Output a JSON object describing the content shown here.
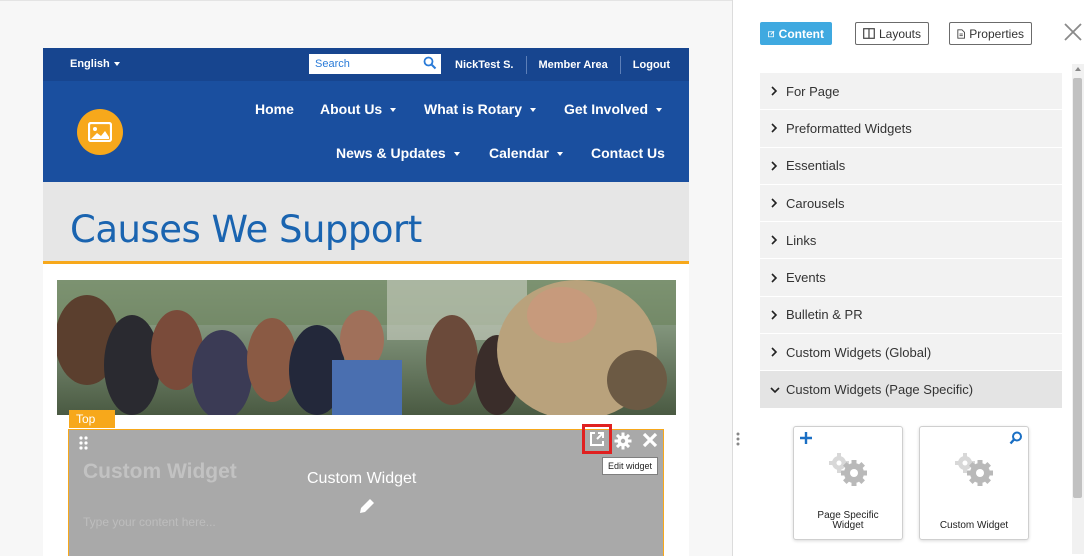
{
  "site": {
    "topbar": {
      "language": "English",
      "search_placeholder": "Search",
      "user": "NickTest S.",
      "member_area": "Member Area",
      "logout": "Logout"
    },
    "nav": {
      "home": "Home",
      "about": "About Us",
      "rotary": "What is Rotary",
      "involved": "Get Involved",
      "news": "News & Updates",
      "calendar": "Calendar",
      "contact": "Contact Us"
    },
    "page_title": "Causes We Support",
    "section_tab": "Top",
    "widget": {
      "ghost_title": "Custom Widget",
      "ghost_body": "Type your content here...",
      "center_label": "Custom Widget",
      "tooltip": "Edit widget"
    }
  },
  "panel": {
    "tabs": {
      "content": "Content",
      "layouts": "Layouts",
      "properties": "Properties"
    },
    "accordion": [
      {
        "label": "For Page"
      },
      {
        "label": "Preformatted Widgets"
      },
      {
        "label": "Essentials"
      },
      {
        "label": "Carousels"
      },
      {
        "label": "Links"
      },
      {
        "label": "Events"
      },
      {
        "label": "Bulletin & PR"
      },
      {
        "label": "Custom Widgets (Global)"
      },
      {
        "label": "Custom Widgets (Page Specific)"
      }
    ],
    "cards": {
      "page_specific_line1": "Page Specific",
      "page_specific_line2": "Widget",
      "custom": "Custom Widget"
    }
  },
  "colors": {
    "topbar": "#17458f",
    "nav": "#1a4f9f",
    "accent_gold": "#f7a81b",
    "title_blue": "#1a64b0",
    "content_tab": "#3fa9e0",
    "highlight_red": "#e02020"
  },
  "icons": {
    "search": "search-icon",
    "image": "image-icon",
    "drag": "drag-handle-icon",
    "edit": "external-link-icon",
    "gear": "gear-icon",
    "close": "close-icon",
    "pencil": "pencil-icon",
    "plus": "plus-icon",
    "magnifier": "search-icon"
  }
}
